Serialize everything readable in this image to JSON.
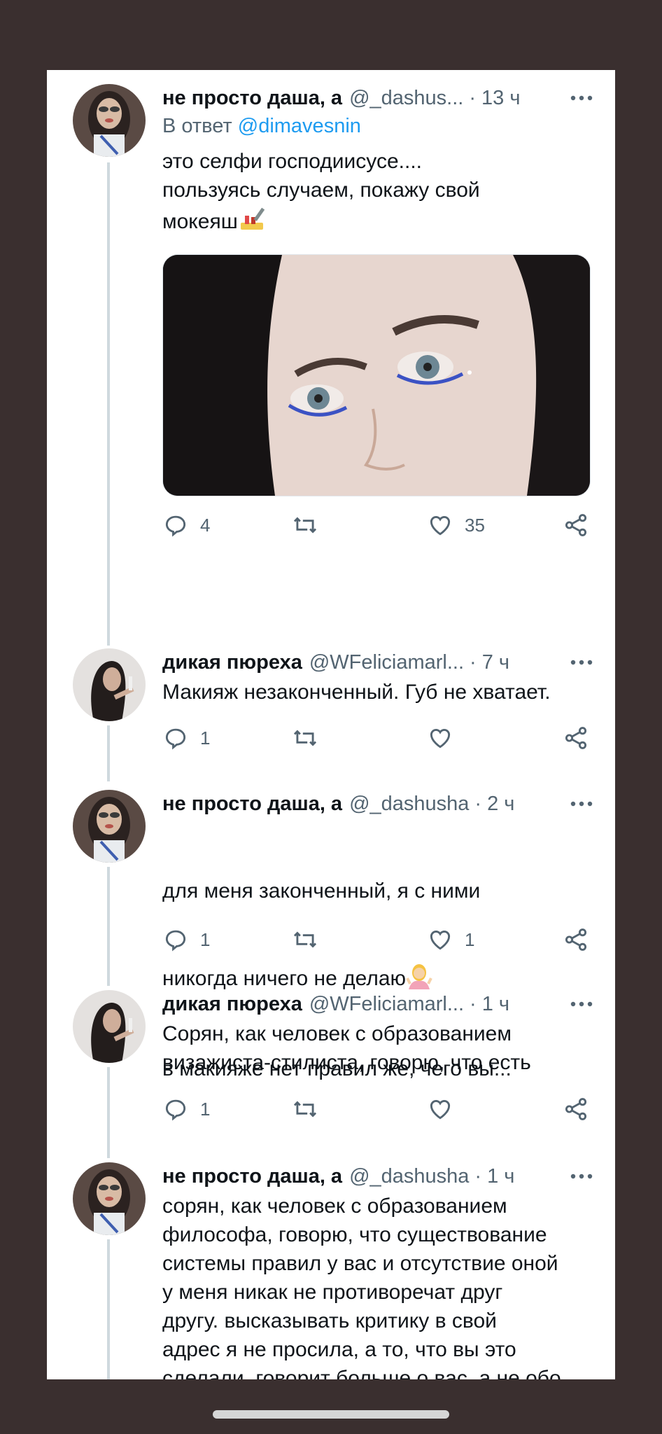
{
  "tweets": [
    {
      "name": "не просто даша, а",
      "handle": "@_dashus...",
      "time": "13 ч",
      "reply_prefix": "В ответ ",
      "reply_mention": "@dimavesnin",
      "text": "это селфи господиисусе....\nпользуясь случаем, покажу свой\nмокеяш",
      "reply_count": "4",
      "retweet_count": "",
      "like_count": "35"
    },
    {
      "name": "дикая пюреха",
      "handle": "@WFeliciamarl...",
      "time": "7 ч",
      "text": "Макияж незаконченный. Губ не хватает.",
      "reply_count": "1",
      "retweet_count": "",
      "like_count": ""
    },
    {
      "name": "не просто даша, а",
      "handle": "@_dashusha",
      "time": "2 ч",
      "text_line1": "для меня законченный, я с ними",
      "text_line2": "никогда ничего не делаю",
      "text_line3": "в макияже нет правил же, чего вы...",
      "reply_count": "1",
      "retweet_count": "",
      "like_count": "1"
    },
    {
      "name": "дикая пюреха",
      "handle": "@WFeliciamarl...",
      "time": "1 ч",
      "text": "Сорян, как человек с образованием\nвизажиста-стилиста, говорю, что есть",
      "reply_count": "1",
      "retweet_count": "",
      "like_count": ""
    },
    {
      "name": "не просто даша, а",
      "handle": "@_dashusha",
      "time": "1 ч",
      "text": "сорян, как человек с образованием\nфилософа, говорю, что существование\nсистемы правил у вас и отсутствие оной\nу меня никак не противоречат друг\nдругу. высказывать критику в свой\nадрес я не просила, а то, что вы это\nсделали, говорит больше о вас, а не обо\nмне. хорошего вам дня!"
    }
  ],
  "colors": {
    "background": "#3a2f2f",
    "card": "#ffffff",
    "link": "#1d9bf0",
    "secondary_text": "#536471",
    "heart_emoji": "#d0213a"
  },
  "icons": [
    "reply-icon",
    "retweet-icon",
    "like-icon",
    "share-icon",
    "more-icon",
    "lipstick-emoji",
    "shrug-emoji",
    "heart-emoji"
  ]
}
